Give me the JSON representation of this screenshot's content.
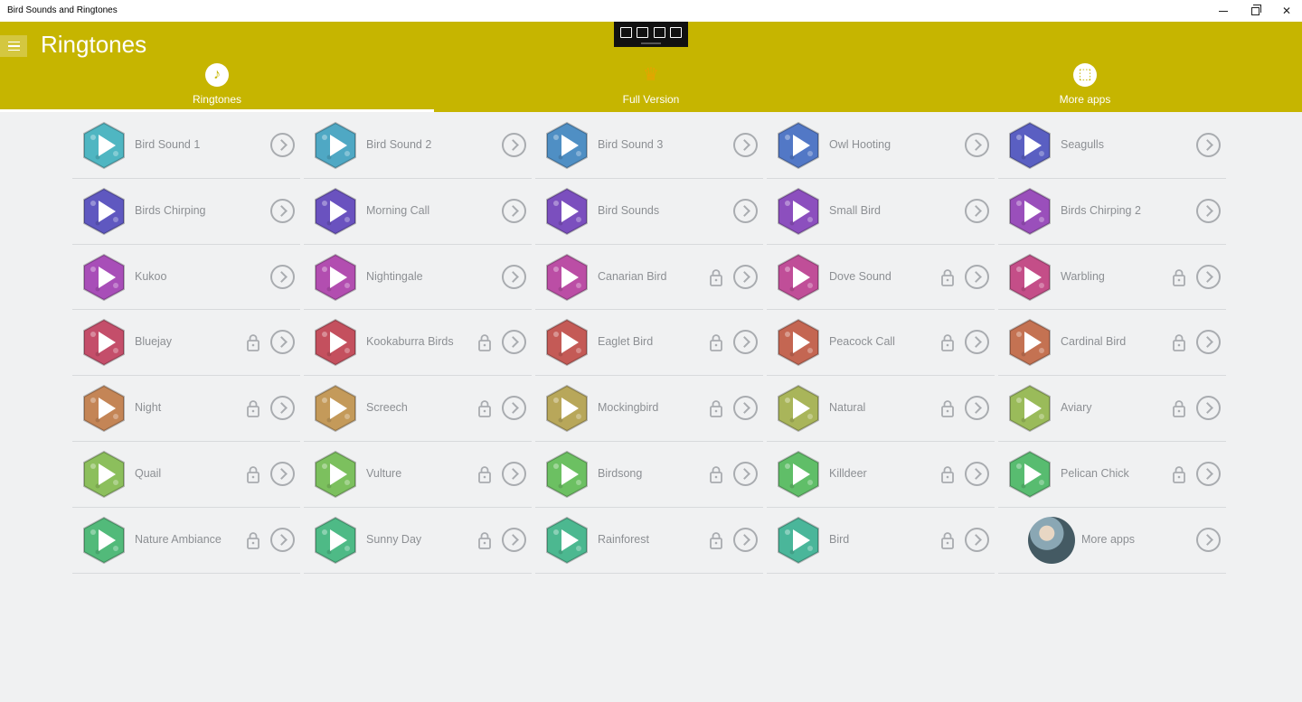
{
  "window": {
    "title": "Bird Sounds and Ringtones"
  },
  "header": {
    "title": "Ringtones"
  },
  "tabs": [
    {
      "label": "Ringtones",
      "icon": "music-note-icon",
      "active": true
    },
    {
      "label": "Full Version",
      "icon": "crown-icon",
      "active": false
    },
    {
      "label": "More apps",
      "icon": "gift-icon",
      "active": false
    }
  ],
  "colors": {
    "accent": "#c6b500",
    "background": "#f0f1f2",
    "text_muted": "#8c8f93"
  },
  "items": [
    {
      "label": "Bird Sound 1",
      "locked": false,
      "color": "#4fb6c2"
    },
    {
      "label": "Bird Sound 2",
      "locked": false,
      "color": "#4fa8c4"
    },
    {
      "label": "Bird Sound 3",
      "locked": false,
      "color": "#4f8fc4"
    },
    {
      "label": "Owl Hooting",
      "locked": false,
      "color": "#5278c6"
    },
    {
      "label": "Seagulls",
      "locked": false,
      "color": "#5a5fc2"
    },
    {
      "label": "Birds Chirping",
      "locked": false,
      "color": "#5f58c0"
    },
    {
      "label": "Morning Call",
      "locked": false,
      "color": "#6a52bf"
    },
    {
      "label": "Bird Sounds",
      "locked": false,
      "color": "#7b4fbe"
    },
    {
      "label": "Small Bird",
      "locked": false,
      "color": "#8c4fbe"
    },
    {
      "label": "Birds Chirping 2",
      "locked": false,
      "color": "#9a4fbb"
    },
    {
      "label": "Kukoo",
      "locked": false,
      "color": "#a84eb8"
    },
    {
      "label": "Nightingale",
      "locked": false,
      "color": "#b24eb0"
    },
    {
      "label": "Canarian Bird",
      "locked": true,
      "color": "#bb4ea5"
    },
    {
      "label": "Dove Sound",
      "locked": true,
      "color": "#c04e98"
    },
    {
      "label": "Warbling",
      "locked": true,
      "color": "#c44e88"
    },
    {
      "label": "Bluejay",
      "locked": true,
      "color": "#c44e6a"
    },
    {
      "label": "Kookaburra Birds",
      "locked": true,
      "color": "#c4505e"
    },
    {
      "label": "Eaglet Bird",
      "locked": true,
      "color": "#c45a56"
    },
    {
      "label": "Peacock Call",
      "locked": true,
      "color": "#c46652"
    },
    {
      "label": "Cardinal Bird",
      "locked": true,
      "color": "#c47252"
    },
    {
      "label": "Night",
      "locked": true,
      "color": "#c48556"
    },
    {
      "label": "Screech",
      "locked": true,
      "color": "#c49a5a"
    },
    {
      "label": "Mockingbird",
      "locked": true,
      "color": "#b8a75a"
    },
    {
      "label": "Natural",
      "locked": true,
      "color": "#a9b55a"
    },
    {
      "label": "Aviary",
      "locked": true,
      "color": "#9abb5a"
    },
    {
      "label": "Quail",
      "locked": true,
      "color": "#8cbf5c"
    },
    {
      "label": "Vulture",
      "locked": true,
      "color": "#7cc05e"
    },
    {
      "label": "Birdsong",
      "locked": true,
      "color": "#6cc062"
    },
    {
      "label": "Killdeer",
      "locked": true,
      "color": "#60be68"
    },
    {
      "label": "Pelican Chick",
      "locked": true,
      "color": "#58bc70"
    },
    {
      "label": "Nature Ambiance",
      "locked": true,
      "color": "#52ba7a"
    },
    {
      "label": "Sunny Day",
      "locked": true,
      "color": "#4eba86"
    },
    {
      "label": "Rainforest",
      "locked": true,
      "color": "#4cb890"
    },
    {
      "label": "Bird",
      "locked": true,
      "color": "#4ab69a"
    },
    {
      "label": "More apps",
      "locked": false,
      "avatar": true
    }
  ]
}
